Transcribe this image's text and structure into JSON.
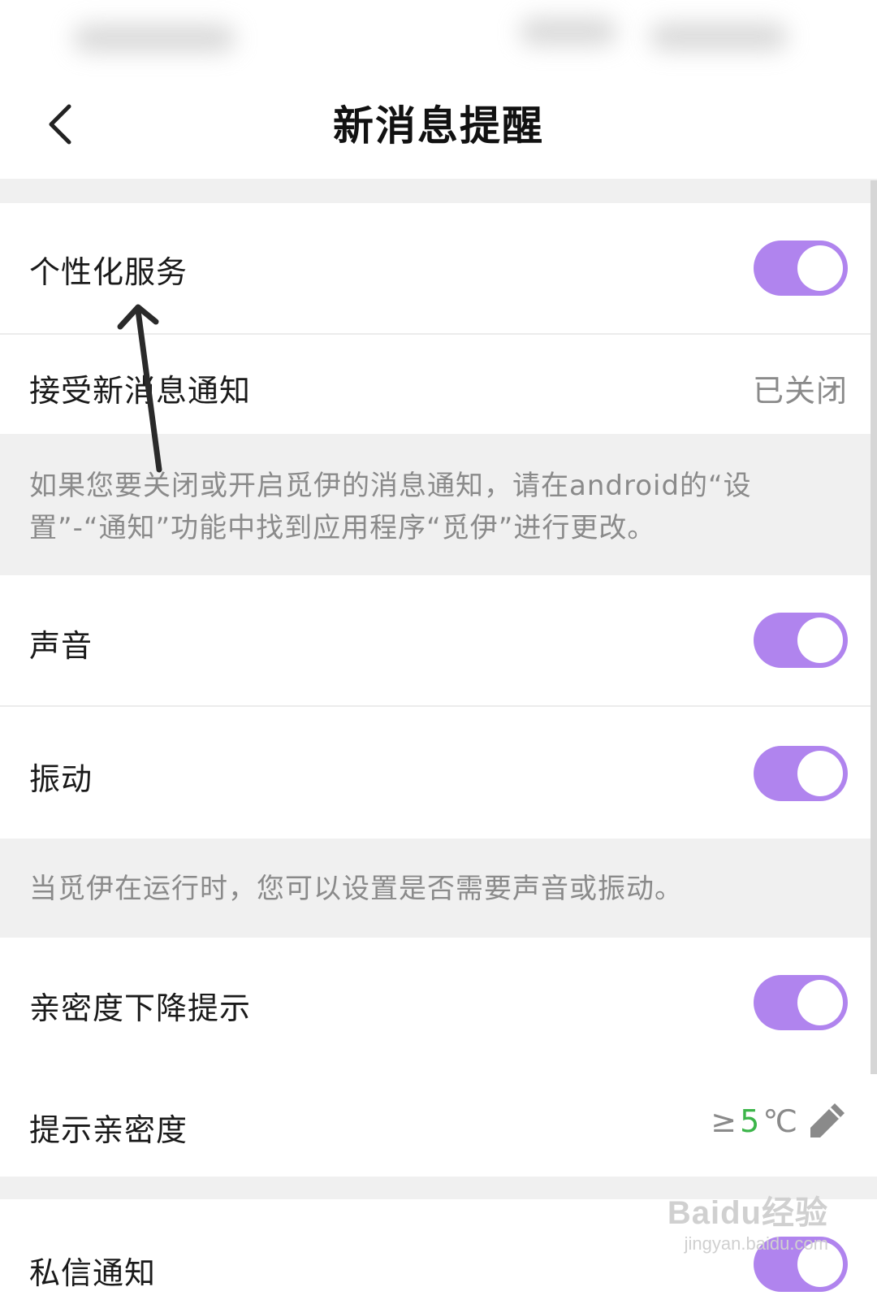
{
  "header": {
    "title": "新消息提醒",
    "back_icon": "chevron-left-icon"
  },
  "settings": {
    "personalized": {
      "label": "个性化服务",
      "enabled": true
    },
    "receive_notifications": {
      "label": "接受新消息通知",
      "value": "已关闭"
    },
    "notification_note": "如果您要关闭或开启觅伊的消息通知，请在android的“设置”-“通知”功能中找到应用程序“觅伊”进行更改。",
    "sound": {
      "label": "声音",
      "enabled": true
    },
    "vibration": {
      "label": "振动",
      "enabled": true
    },
    "runtime_note": "当觅伊在运行时，您可以设置是否需要声音或振动。",
    "intimacy_drop": {
      "label": "亲密度下降提示",
      "enabled": true
    },
    "intimacy_threshold": {
      "label": "提示亲密度",
      "prefix": "≥",
      "value": "5",
      "unit": "℃",
      "edit_icon": "pencil-icon"
    },
    "private_message": {
      "label": "私信通知",
      "enabled": true
    }
  },
  "watermark": {
    "logo": "Baidu经验",
    "url": "jingyan.baidu.com"
  },
  "colors": {
    "toggle_on": "#b084ee",
    "accent_value": "#3cb54a",
    "section_bg": "#f0f0f0"
  }
}
